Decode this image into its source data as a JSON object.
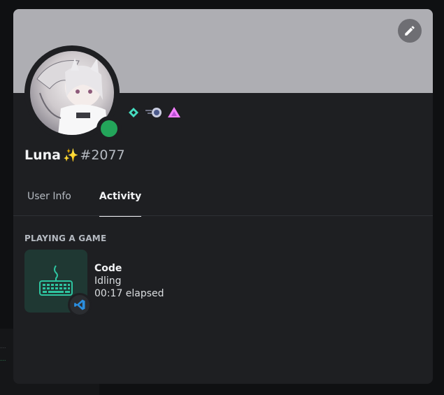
{
  "backdrop": {
    "line1": "...",
    "line2": "..."
  },
  "profile": {
    "username": "Luna",
    "sparkle": "✨",
    "discriminator": "#2077",
    "status": "online",
    "status_color": "#23a55a",
    "banner_color": "#aeaeb3",
    "badges": [
      "hypesquad-balance-icon",
      "nitro-orb-icon",
      "boost-pink-icon"
    ]
  },
  "tabs": [
    {
      "label": "User Info",
      "active": false
    },
    {
      "label": "Activity",
      "active": true
    }
  ],
  "activity": {
    "section_header": "PLAYING A GAME",
    "name": "Code",
    "details": "Idling",
    "elapsed": "00:17 elapsed",
    "large_image": "keyboard-icon",
    "small_image": "vscode-icon"
  }
}
